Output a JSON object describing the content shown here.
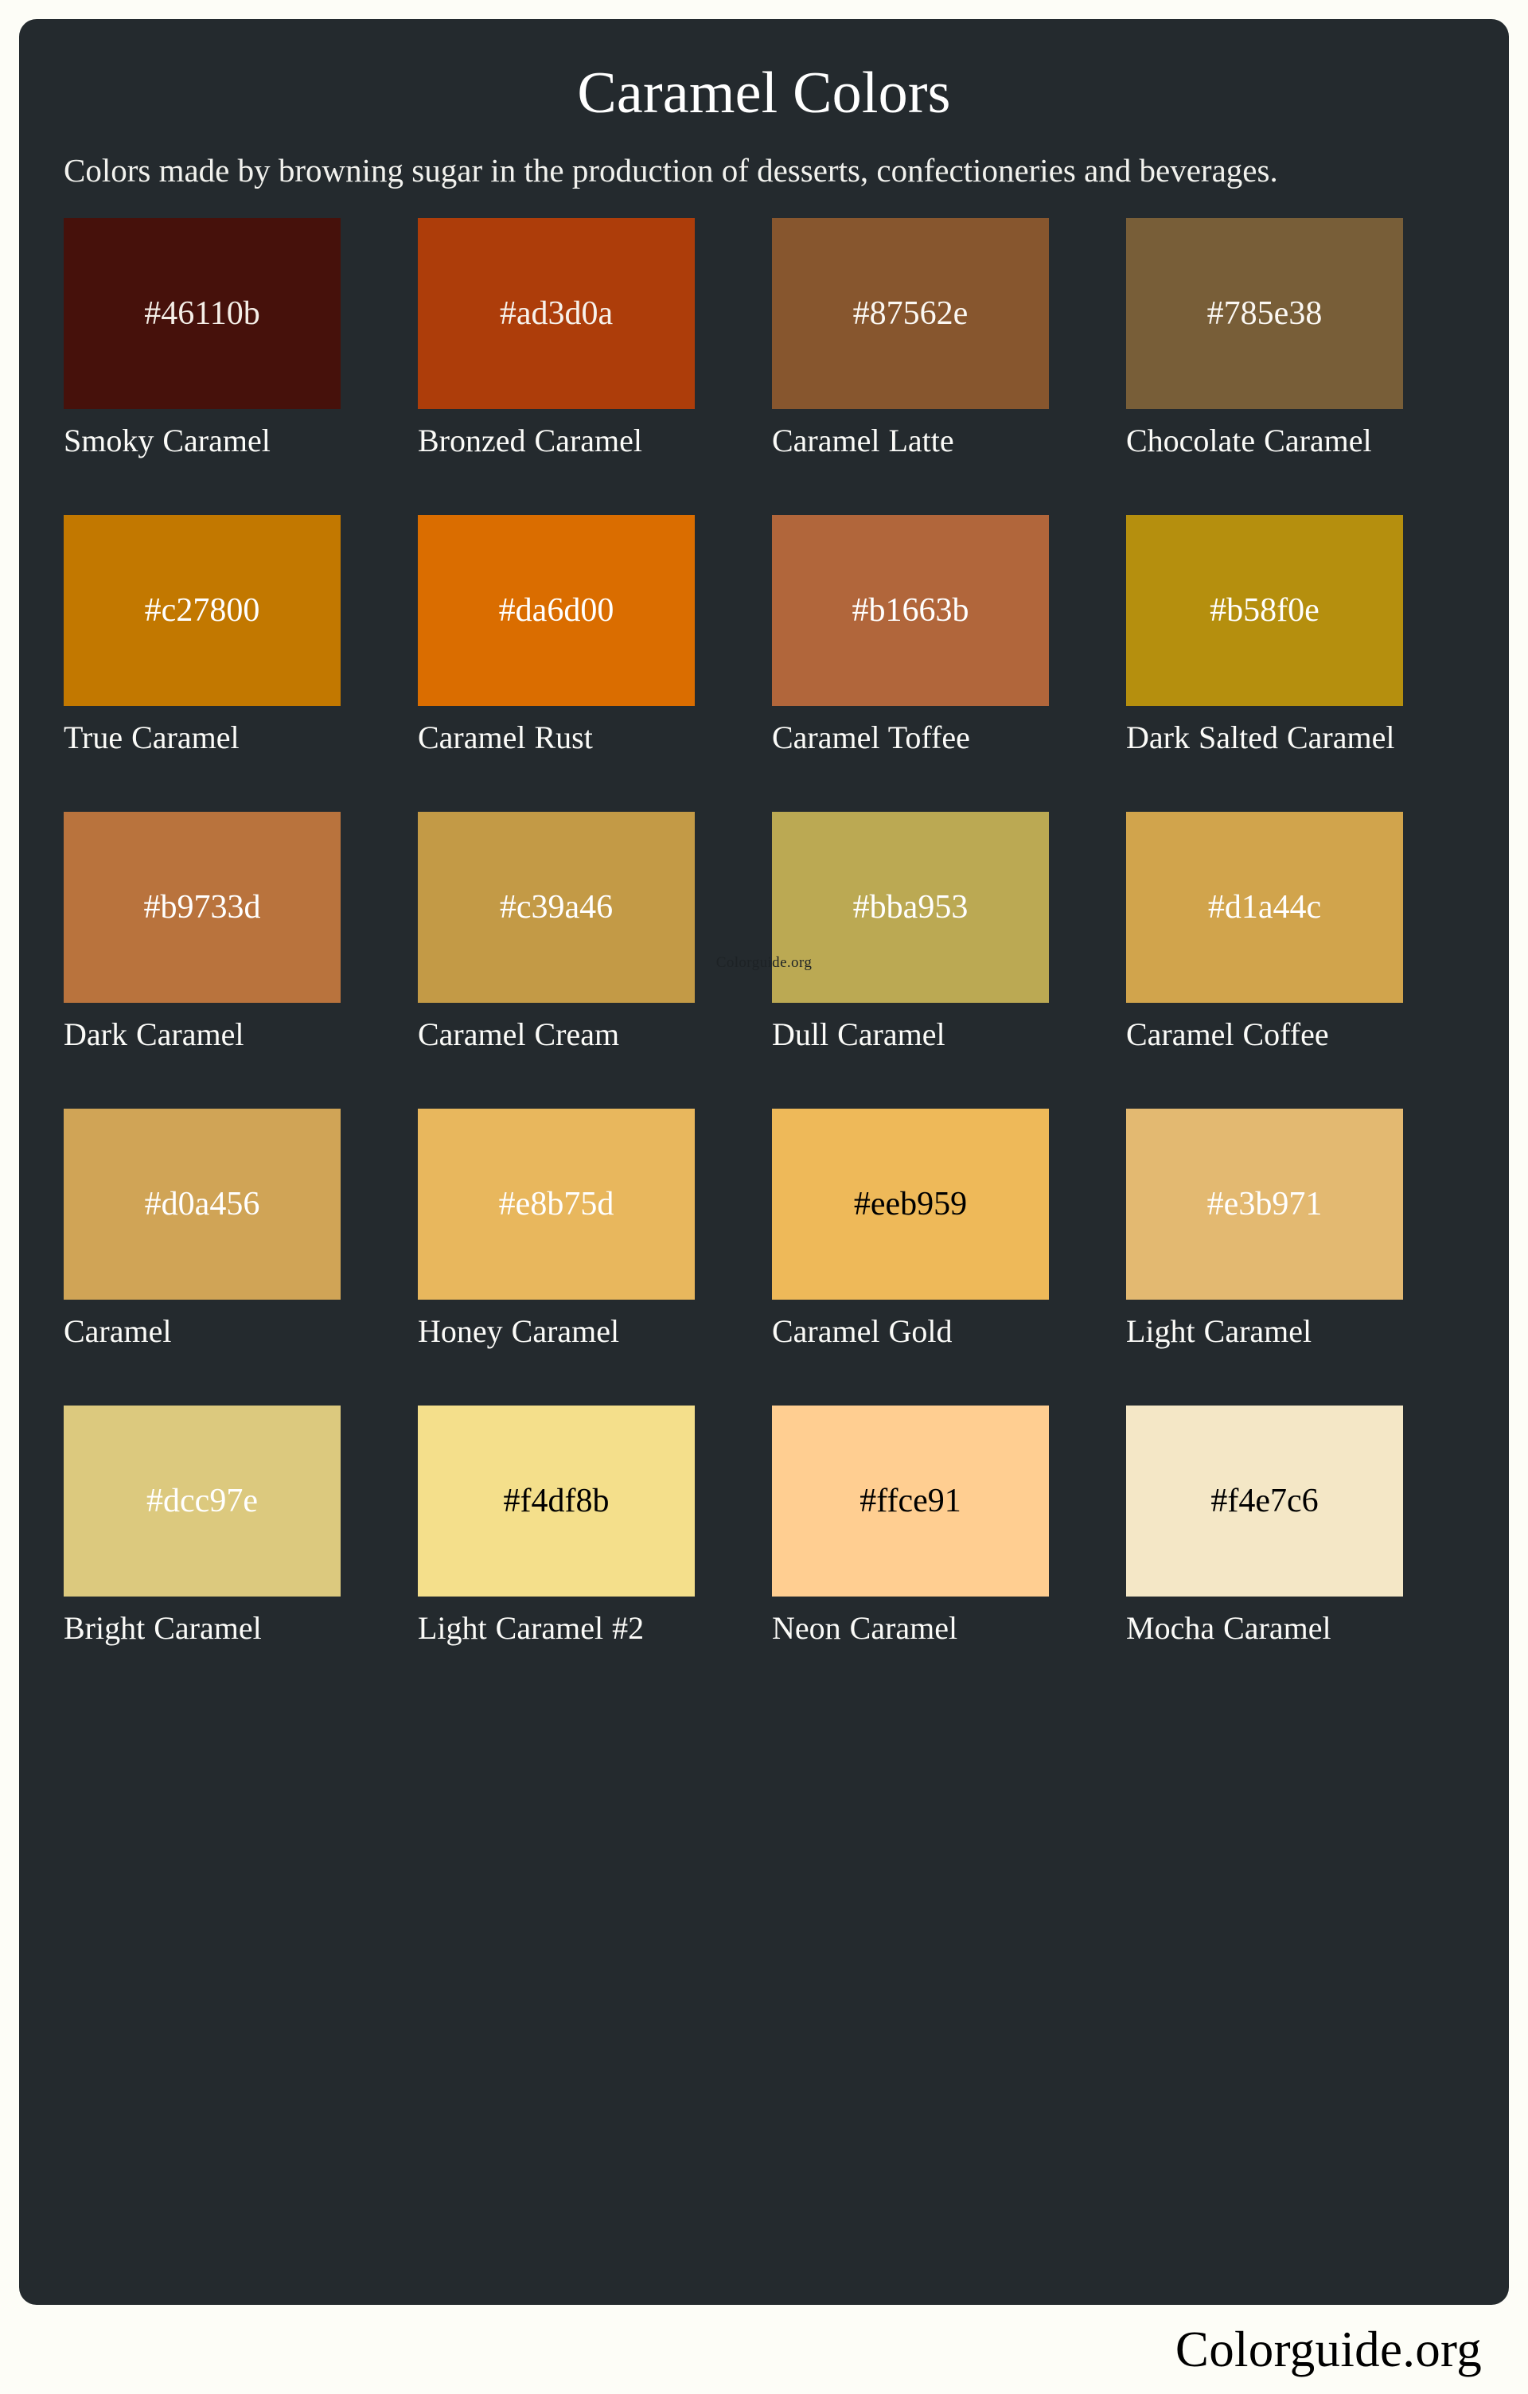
{
  "card": {
    "title": "Caramel Colors",
    "description": "Colors made by browning sugar in the production of desserts, confectioneries and beverages.",
    "background": "#242a2e",
    "text_color": "#ffffff"
  },
  "page": {
    "background": "#fdfdf7"
  },
  "watermark": {
    "text": "Colorguide.org",
    "color": "#1d2225"
  },
  "footer": {
    "brand": "Colorguide.org",
    "color": "#000000"
  },
  "swatches": [
    {
      "hex": "#46110b",
      "name": "Smoky Caramel",
      "label_text_color": "#f5efe8"
    },
    {
      "hex": "#ad3d0a",
      "name": "Bronzed Caramel",
      "label_text_color": "#f7f2ec"
    },
    {
      "hex": "#87562e",
      "name": "Caramel Latte",
      "label_text_color": "#fbf8f3"
    },
    {
      "hex": "#785e38",
      "name": "Chocolate Caramel",
      "label_text_color": "#fbf8f3"
    },
    {
      "hex": "#c27800",
      "name": "True Caramel",
      "label_text_color": "#ffffff"
    },
    {
      "hex": "#da6d00",
      "name": "Caramel Rust",
      "label_text_color": "#ffffff"
    },
    {
      "hex": "#b1663b",
      "name": "Caramel Toffee",
      "label_text_color": "#ffffff"
    },
    {
      "hex": "#b58f0e",
      "name": "Dark Salted Caramel",
      "label_text_color": "#ffffff"
    },
    {
      "hex": "#b9733d",
      "name": "Dark Caramel",
      "label_text_color": "#ffffff"
    },
    {
      "hex": "#c39a46",
      "name": "Caramel Cream",
      "label_text_color": "#ffffff"
    },
    {
      "hex": "#bba953",
      "name": "Dull Caramel",
      "label_text_color": "#ffffff"
    },
    {
      "hex": "#d1a44c",
      "name": "Caramel Coffee",
      "label_text_color": "#ffffff"
    },
    {
      "hex": "#d0a456",
      "name": "Caramel",
      "label_text_color": "#ffffff"
    },
    {
      "hex": "#e8b75d",
      "name": "Honey Caramel",
      "label_text_color": "#ffffff"
    },
    {
      "hex": "#eeb959",
      "name": "Caramel Gold",
      "label_text_color": "#000000"
    },
    {
      "hex": "#e3b971",
      "name": "Light Caramel",
      "label_text_color": "#ffffff"
    },
    {
      "hex": "#dcc97e",
      "name": "Bright Caramel",
      "label_text_color": "#ffffff"
    },
    {
      "hex": "#f4df8b",
      "name": "Light Caramel #2",
      "label_text_color": "#000000"
    },
    {
      "hex": "#ffce91",
      "name": "Neon Caramel",
      "label_text_color": "#000000"
    },
    {
      "hex": "#f4e7c6",
      "name": "Mocha Caramel",
      "label_text_color": "#000000"
    }
  ]
}
